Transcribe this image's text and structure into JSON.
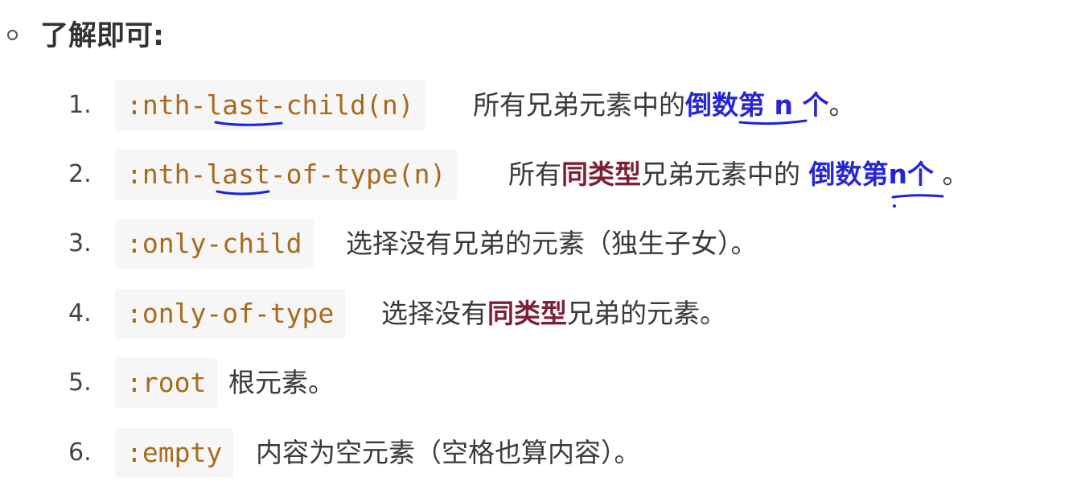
{
  "heading": "了解即可:",
  "items": [
    {
      "num": "1.",
      "code": ":nth-last-child(n)",
      "desc": {
        "a": "所有兄弟元素中的",
        "b": "倒数第 n 个",
        "c": "。"
      }
    },
    {
      "num": "2.",
      "code": ":nth-last-of-type(n)",
      "desc": {
        "a": "所有",
        "b": "同类型",
        "c": "兄弟元素中的 ",
        "d": "倒数第n个",
        "e": " 。"
      }
    },
    {
      "num": "3.",
      "code": ":only-child",
      "desc": {
        "a": "选择没有兄弟的元素（独生子女）。"
      }
    },
    {
      "num": "4.",
      "code": ":only-of-type",
      "desc": {
        "a": "选择没有",
        "b": "同类型",
        "c": "兄弟的元素。"
      }
    },
    {
      "num": "5.",
      "code": ":root",
      "desc": {
        "a": "根元素。"
      }
    },
    {
      "num": "6.",
      "code": ":empty",
      "desc": {
        "a": "内容为空元素（空格也算内容）。"
      }
    }
  ],
  "colors": {
    "code_text": "#a86a1c",
    "code_bg": "#f6f6f6",
    "emphasis_blue": "#2626d6",
    "emphasis_red": "#7d1f35",
    "annotation_ink": "#1a22e0"
  }
}
